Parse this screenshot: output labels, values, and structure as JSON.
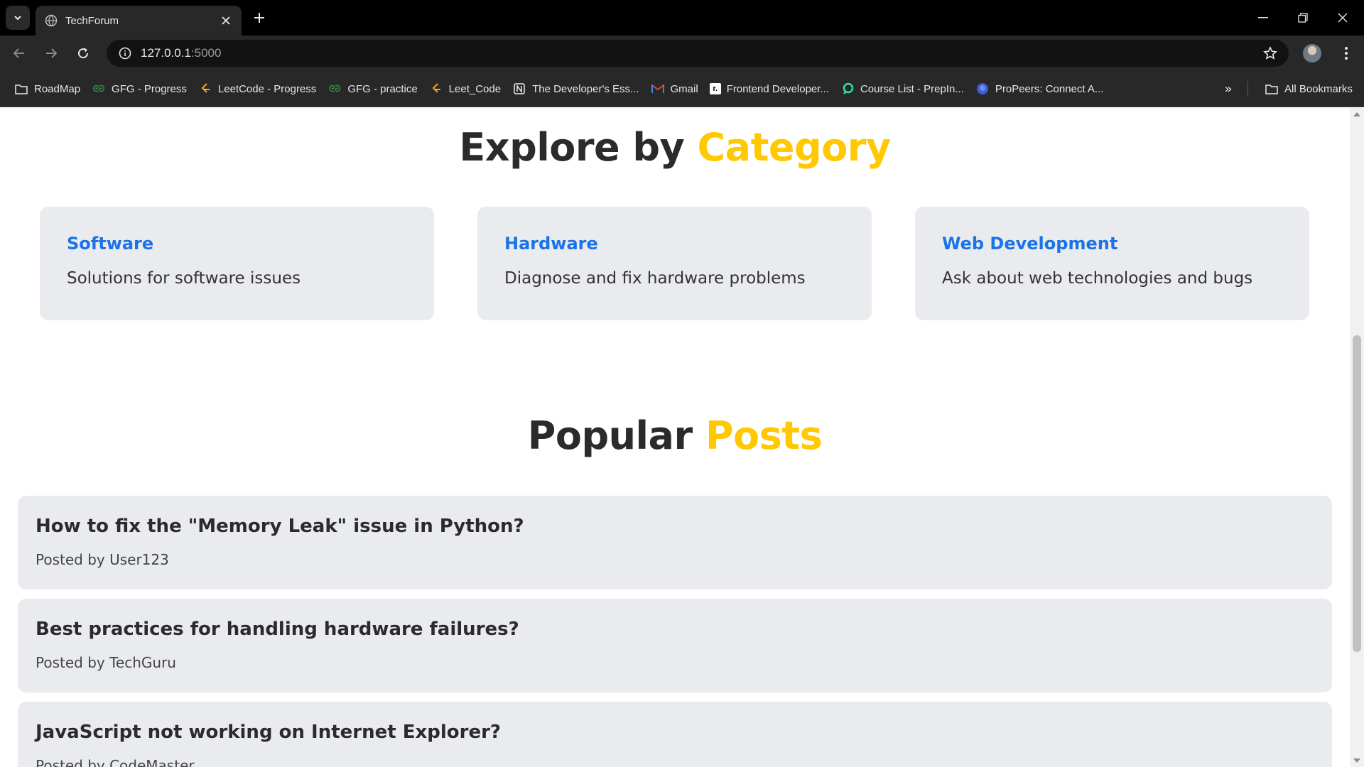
{
  "browser": {
    "tab_title": "TechForum",
    "url_host": "127.0.0.1",
    "url_port": ":5000"
  },
  "bookmarks": [
    {
      "label": "RoadMap",
      "icon": "folder-icon"
    },
    {
      "label": "GFG - Progress",
      "icon": "gfg-icon"
    },
    {
      "label": "LeetCode - Progress",
      "icon": "leetcode-icon"
    },
    {
      "label": "GFG - practice",
      "icon": "gfg-icon"
    },
    {
      "label": "Leet_Code",
      "icon": "leetcode-icon"
    },
    {
      "label": "The Developer's Ess...",
      "icon": "notion-icon"
    },
    {
      "label": "Gmail",
      "icon": "gmail-icon"
    },
    {
      "label": "Frontend Developer...",
      "icon": "frontend-icon"
    },
    {
      "label": "Course List - PrepIn...",
      "icon": "prepinsta-icon"
    },
    {
      "label": "ProPeers: Connect A...",
      "icon": "propeers-icon"
    }
  ],
  "all_bookmarks_label": "All Bookmarks",
  "explore": {
    "title_main": "Explore by",
    "title_accent": "Category",
    "categories": [
      {
        "name": "Software",
        "description": "Solutions for software issues"
      },
      {
        "name": "Hardware",
        "description": "Diagnose and fix hardware problems"
      },
      {
        "name": "Web Development",
        "description": "Ask about web technologies and bugs"
      }
    ]
  },
  "popular": {
    "title_main": "Popular",
    "title_accent": "Posts",
    "posted_by_label": "Posted by",
    "posts": [
      {
        "title": "How to fix the \"Memory Leak\" issue in Python?",
        "author": "User123"
      },
      {
        "title": "Best practices for handling hardware failures?",
        "author": "TechGuru"
      },
      {
        "title": "JavaScript not working on Internet Explorer?",
        "author": "CodeMaster"
      }
    ]
  },
  "colors": {
    "accent": "#ffc800",
    "link": "#1a73e8",
    "card_bg": "#e9ebee",
    "heading": "#2b2b2b"
  }
}
